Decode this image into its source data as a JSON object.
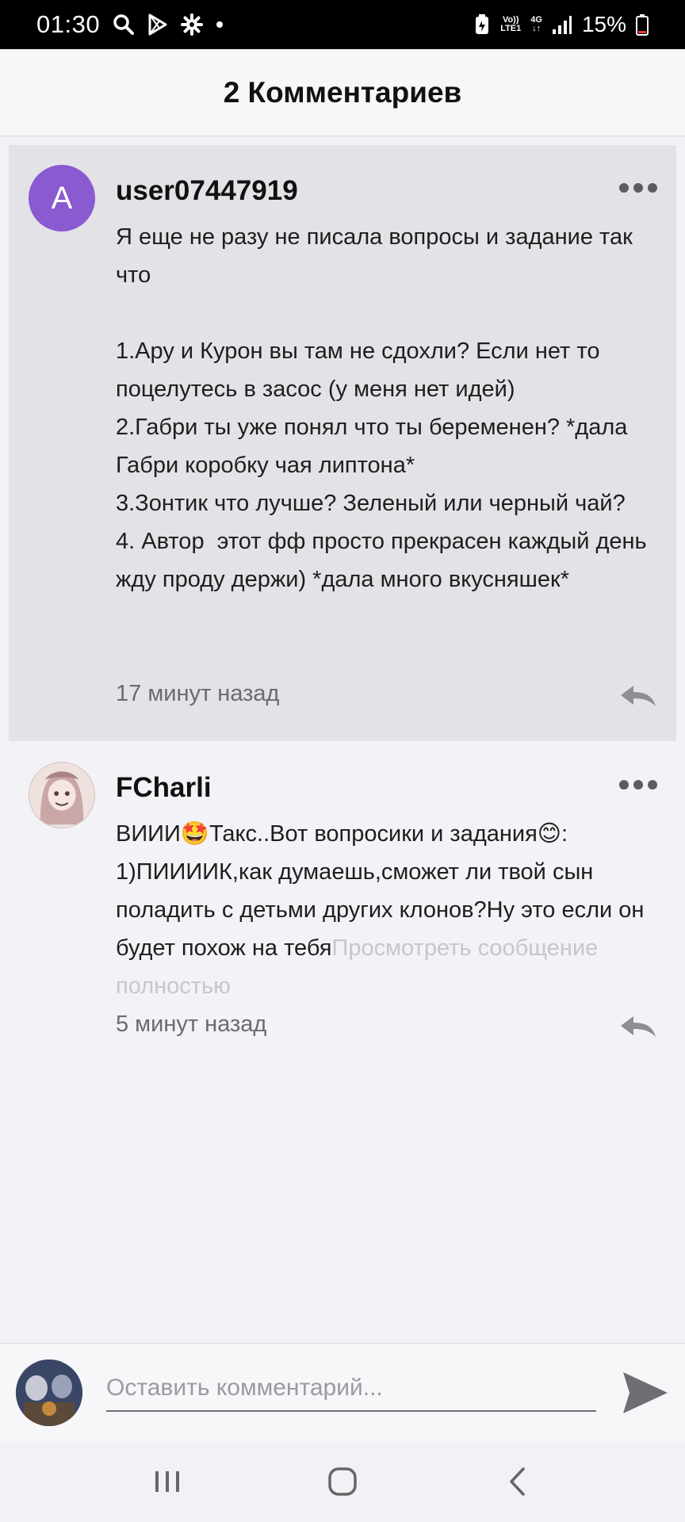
{
  "status_bar": {
    "time": "01:30",
    "battery": "15%",
    "network": "4G",
    "volte": "Vo))",
    "lte": "LTE1"
  },
  "header": {
    "title": "2 Комментариев"
  },
  "comments": [
    {
      "avatar_letter": "A",
      "username": "user07447919",
      "text": "Я еще не разу не писала вопросы и задание так что\n\n1.Ару и Курон вы там не сдохли? Если нет то поцелутесь в засос (у меня нет идей)\n2.Габри ты уже понял что ты беременен? *дала Габри коробку чая липтона*\n3.Зонтик что лучше? Зеленый или черный чай?\n4. Автор  этот фф просто прекрасен каждый день жду проду держи) *дала много вкусняшек*",
      "time": "17 минут назад"
    },
    {
      "username": "FCharli",
      "text": "ВИИИ🤩Такс..Вот вопросики и задания😊:\n1)ПИИИИК,как думаешь,сможет ли твой сын поладить с детьми других клонов?Ну это если он будет похож на тебя",
      "expand_label": "Просмотреть сообщение полностью",
      "time": "5 минут назад"
    }
  ],
  "input": {
    "placeholder": "Оставить комментарий..."
  },
  "colors": {
    "avatar_purple": "#8a5ad1",
    "highlight_bg": "#e3e2e6",
    "page_bg": "#f2f1f5"
  }
}
